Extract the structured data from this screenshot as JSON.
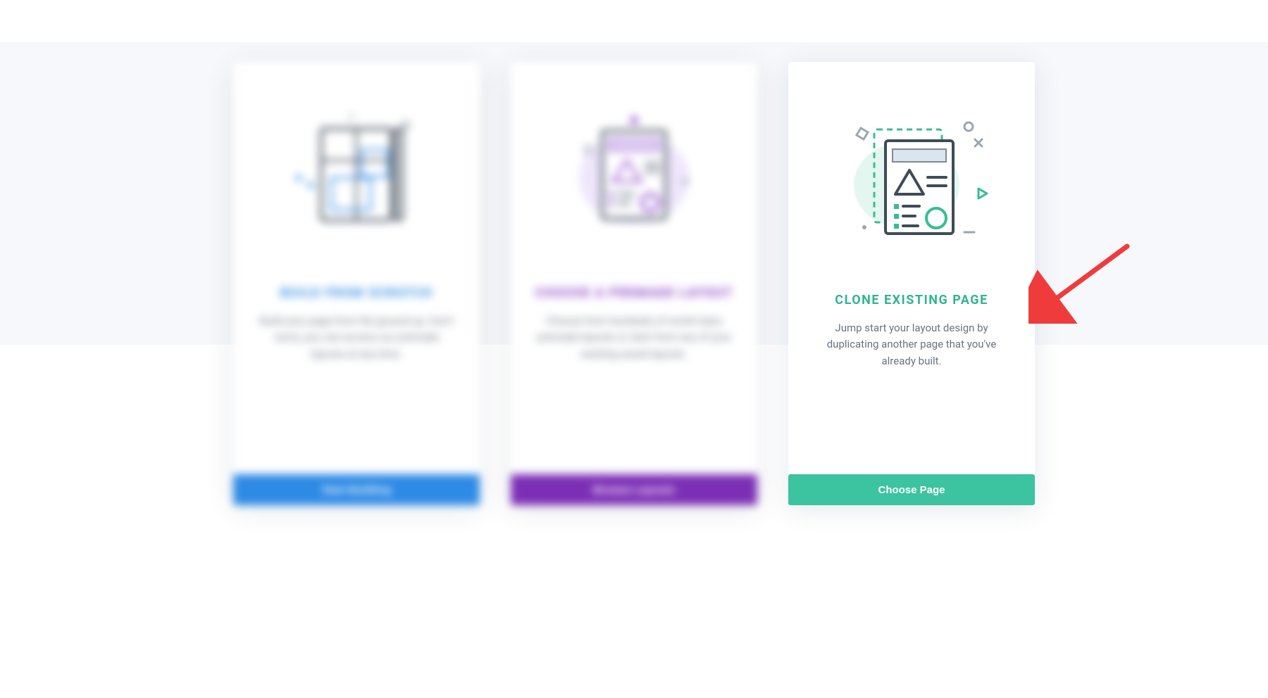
{
  "colors": {
    "blue": "#2d8ae5",
    "purple": "#7c2fb5",
    "teal": "#3cc3a0",
    "text_muted": "#6a7480",
    "arrow": "#ef3b3b"
  },
  "cards": [
    {
      "id": "scratch",
      "title": "BUILD FROM SCRATCH",
      "description": "Build your page from the ground up. Don't worry, you can access our premade layouts at any time.",
      "button_label": "Start Building",
      "icon": "build-from-scratch-icon"
    },
    {
      "id": "premade",
      "title": "CHOOSE A PREMADE LAYOUT",
      "description": "Choose from hundreds of world-class premade layouts or start from any of your existing saved layouts.",
      "button_label": "Browse Layouts",
      "icon": "premade-layout-icon"
    },
    {
      "id": "clone",
      "title": "CLONE EXISTING PAGE",
      "description": "Jump start your layout design by duplicating another page that you've already built.",
      "button_label": "Choose Page",
      "icon": "clone-page-icon"
    }
  ],
  "annotation": {
    "type": "arrow",
    "points_to": "clone-card-title"
  }
}
